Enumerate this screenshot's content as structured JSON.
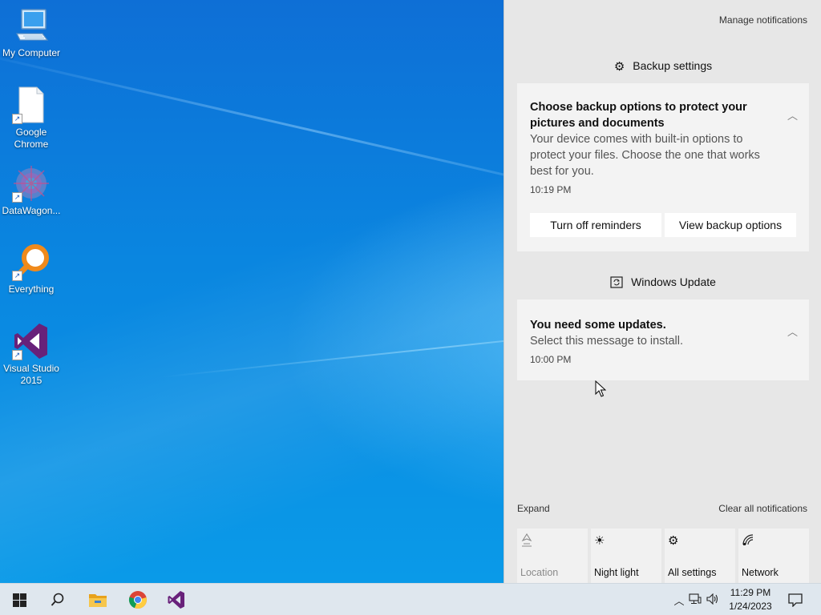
{
  "desktop": {
    "icons": [
      {
        "label": "My Computer"
      },
      {
        "label": "Google Chrome"
      },
      {
        "label": "DataWagon..."
      },
      {
        "label": "Everything"
      },
      {
        "label": "Visual Studio 2015"
      }
    ]
  },
  "action_center": {
    "manage_notifications": "Manage notifications",
    "groups": [
      {
        "header": "Backup settings",
        "icon": "gear-icon",
        "notification": {
          "title": "Choose backup options to protect your pictures and documents",
          "body": "Your device comes with built-in options to protect your files. Choose the one that works best for you.",
          "time": "10:19 PM",
          "buttons": [
            "Turn off reminders",
            "View backup options"
          ]
        }
      },
      {
        "header": "Windows Update",
        "icon": "windows-update-icon",
        "notification": {
          "title": "You need some updates.",
          "body": "Select this message to install.",
          "time": "10:00 PM"
        }
      }
    ],
    "expand": "Expand",
    "clear_all": "Clear all notifications",
    "quick_actions": [
      {
        "label": "Location",
        "icon": "location-icon",
        "state": "off"
      },
      {
        "label": "Night light",
        "icon": "night-light-icon",
        "state": "on"
      },
      {
        "label": "All settings",
        "icon": "gear-icon",
        "state": "on"
      },
      {
        "label": "Network",
        "icon": "network-icon",
        "state": "on"
      }
    ]
  },
  "taskbar": {
    "pinned": [
      "start-button",
      "search-button",
      "file-explorer",
      "google-chrome",
      "visual-studio"
    ],
    "clock": {
      "time": "11:29 PM",
      "date": "1/24/2023"
    }
  },
  "colors": {
    "accent": "#0078d7",
    "action_center_bg": "#e7e7e7",
    "taskbar_bg": "#dfe7ee"
  }
}
